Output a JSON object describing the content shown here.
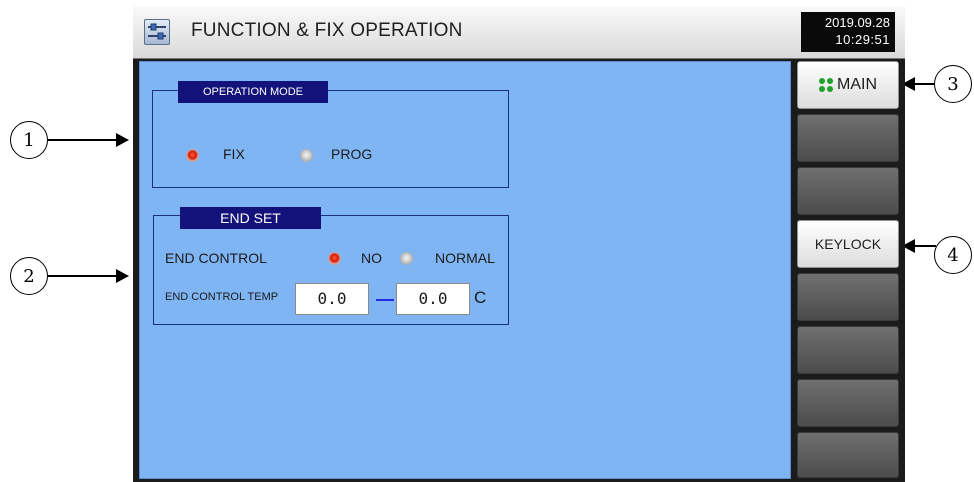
{
  "header": {
    "title": "FUNCTION & FIX OPERATION",
    "date": "2019.09.28",
    "time": "10:29:51",
    "icon": "settings-sliders-icon"
  },
  "operation_mode": {
    "title": "OPERATION MODE",
    "options": [
      {
        "label": "FIX",
        "selected": true
      },
      {
        "label": "PROG",
        "selected": false
      }
    ]
  },
  "end_set": {
    "title": "END SET",
    "control_label": "END CONTROL",
    "options": [
      {
        "label": "NO",
        "selected": true
      },
      {
        "label": "NORMAL",
        "selected": false
      }
    ],
    "temp_label": "END CONTROL TEMP",
    "temp_min": "0.0",
    "temp_max": "0.0",
    "unit": "C"
  },
  "side_buttons": [
    {
      "label": "MAIN",
      "icon": "grid-dots-icon"
    },
    {
      "label": ""
    },
    {
      "label": ""
    },
    {
      "label": "KEYLOCK"
    },
    {
      "label": ""
    },
    {
      "label": ""
    },
    {
      "label": ""
    },
    {
      "label": ""
    }
  ],
  "callouts": [
    "1",
    "2",
    "3",
    "4"
  ],
  "colors": {
    "panel_bg": "#80b5f4",
    "title_bg": "#12127a",
    "radio_on": "#d51c0c",
    "main_dots": "#1fa12c"
  }
}
